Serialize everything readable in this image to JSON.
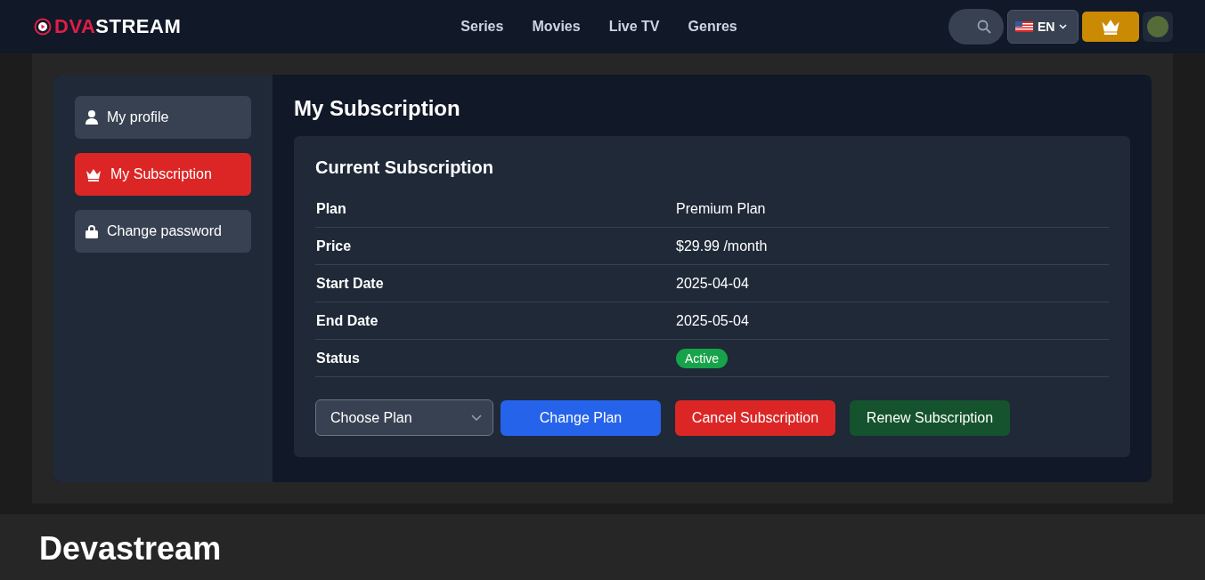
{
  "header": {
    "logo": {
      "part_1": "DVA",
      "part_2": "STREAM"
    },
    "nav": [
      {
        "label": "Series"
      },
      {
        "label": "Movies"
      },
      {
        "label": "Live TV"
      },
      {
        "label": "Genres"
      }
    ],
    "language": "EN"
  },
  "sidebar": {
    "items": [
      {
        "label": "My profile",
        "kind": "profile",
        "selected": false
      },
      {
        "label": "My Subscription",
        "kind": "subscription",
        "selected": true
      },
      {
        "label": "Change password",
        "kind": "password",
        "selected": false
      }
    ]
  },
  "page_title": "My Subscription",
  "card": {
    "title": "Current Subscription",
    "rows": [
      {
        "label": "Plan",
        "value": "Premium Plan",
        "kind": "text"
      },
      {
        "label": "Price",
        "value": "$29.99 /month",
        "kind": "text"
      },
      {
        "label": "Start Date",
        "value": "2025-04-04",
        "kind": "text"
      },
      {
        "label": "End Date",
        "value": "2025-05-04",
        "kind": "text"
      },
      {
        "label": "Status",
        "value": "Active",
        "kind": "badge",
        "color": "#16a34a"
      }
    ],
    "plan_select": "Choose Plan",
    "buttons": [
      {
        "label": "Change Plan",
        "kind": "primary"
      },
      {
        "label": "Cancel Subscription",
        "kind": "danger"
      },
      {
        "label": "Renew Subscription",
        "kind": "success"
      }
    ]
  },
  "footer": {
    "title": "Devastream"
  }
}
